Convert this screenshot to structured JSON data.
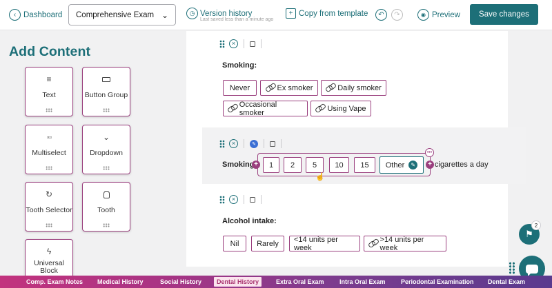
{
  "toolbar": {
    "back_label": "Dashboard",
    "template_value": "Comprehensive Exam",
    "version_history_label": "Version history",
    "last_saved": "Last saved less than a minute ago",
    "copy_template_label": "Copy from template",
    "preview_label": "Preview",
    "save_label": "Save changes"
  },
  "sidebar": {
    "title": "Add Content",
    "items": [
      {
        "label": "Text",
        "icon": "lines-icon"
      },
      {
        "label": "Button Group",
        "icon": "button-group-icon"
      },
      {
        "label": "Multiselect",
        "icon": "grid-icon"
      },
      {
        "label": "Dropdown",
        "icon": "chevron-down-icon"
      },
      {
        "label": "Tooth Selector",
        "icon": "refresh-icon"
      },
      {
        "label": "Tooth",
        "icon": "tooth-icon"
      },
      {
        "label": "Universal Block",
        "icon": "bolt-icon"
      }
    ]
  },
  "blocks": {
    "smoking": {
      "label": "Smoking:",
      "options": [
        "Never",
        "Ex smoker",
        "Daily smoker",
        "Occasional smoker",
        "Using Vape"
      ]
    },
    "smoking_amount": {
      "label": "Smoking:",
      "options": [
        "1",
        "2",
        "5",
        "10",
        "15"
      ],
      "other_label": "Other",
      "suffix": "cigarettes a day"
    },
    "alcohol": {
      "label": "Alcohol intake:",
      "options": [
        "Nil",
        "Rarely",
        "<14 units per week",
        ">14 units per week"
      ]
    }
  },
  "notifications": {
    "count": "2"
  },
  "tabs": [
    {
      "label": "Comp. Exam Notes",
      "active": false
    },
    {
      "label": "Medical History",
      "active": false
    },
    {
      "label": "Social History",
      "active": false
    },
    {
      "label": "Dental History",
      "active": true
    },
    {
      "label": "Extra Oral Exam",
      "active": false
    },
    {
      "label": "Intra Oral Exam",
      "active": false
    },
    {
      "label": "Periodontal Examination",
      "active": false
    },
    {
      "label": "Dental Exam",
      "active": false
    }
  ],
  "colors": {
    "primary": "#1d6f78",
    "accent": "#9a3f7e"
  }
}
